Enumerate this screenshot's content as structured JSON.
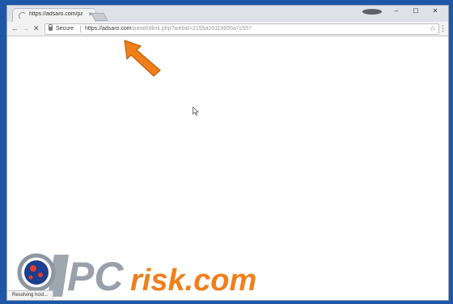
{
  "browser": {
    "tab": {
      "title": "https://adsaro.com/panel",
      "close": "×"
    },
    "window_controls": {
      "minimize": "–",
      "maximize": "☐",
      "close": "✕"
    },
    "nav": {
      "back": "←",
      "forward": "→",
      "stop": "✕"
    },
    "omnibox": {
      "security_label": "Secure",
      "url_host": "https://adsaro.com",
      "url_path": "/panel/dlink.php?webid=2155a29119655a7c557"
    },
    "menu": "⋮",
    "star": "☆",
    "status_text": "Resolving host..."
  },
  "watermark": {
    "brand": "PCrisk.com"
  },
  "colors": {
    "background": "#1e56a8",
    "annotation_arrow": "#f07f1b",
    "watermark_orange": "#f07f1b",
    "watermark_gray": "#8d96a1"
  }
}
